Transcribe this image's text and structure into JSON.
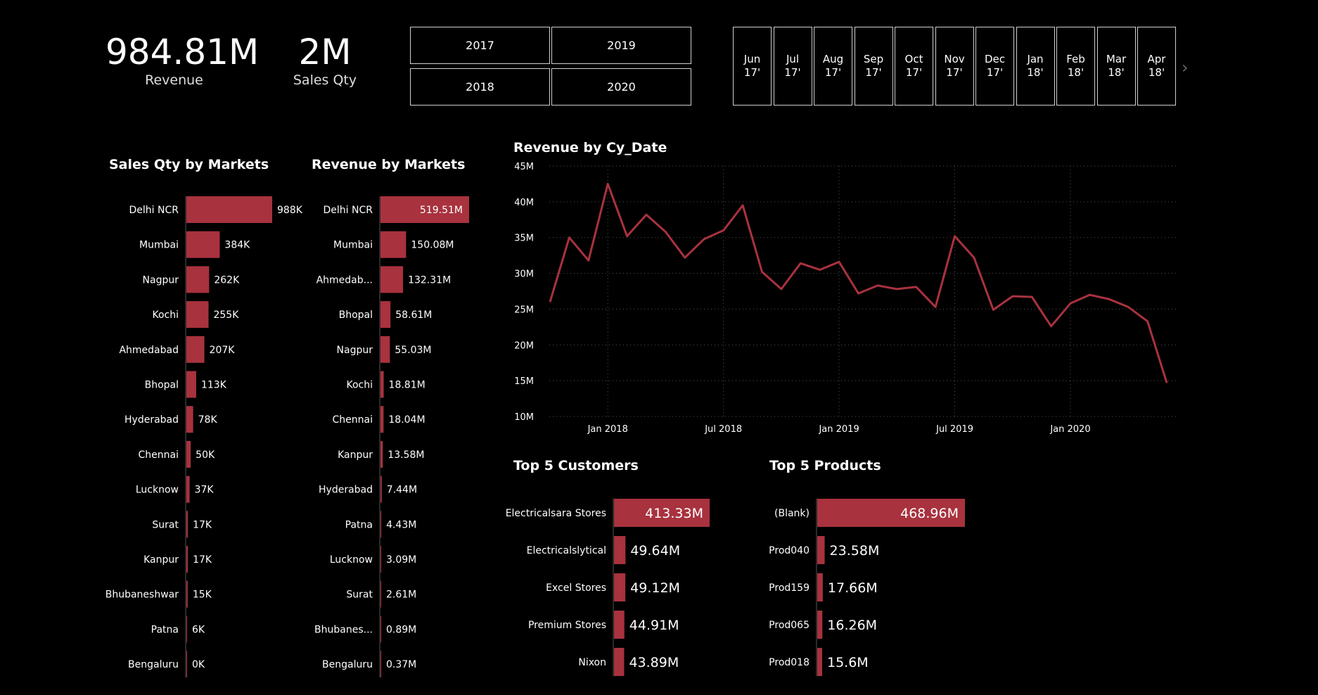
{
  "kpis": {
    "revenue": {
      "value": "984.81M",
      "label": "Revenue"
    },
    "sales_qty": {
      "value": "2M",
      "label": "Sales Qty"
    }
  },
  "year_slicer": [
    "2017",
    "2019",
    "2018",
    "2020"
  ],
  "month_slicer": [
    {
      "m": "Jun",
      "y": "17'"
    },
    {
      "m": "Jul",
      "y": "17'"
    },
    {
      "m": "Aug",
      "y": "17'"
    },
    {
      "m": "Sep",
      "y": "17'"
    },
    {
      "m": "Oct",
      "y": "17'"
    },
    {
      "m": "Nov",
      "y": "17'"
    },
    {
      "m": "Dec",
      "y": "17'"
    },
    {
      "m": "Jan",
      "y": "18'"
    },
    {
      "m": "Feb",
      "y": "18'"
    },
    {
      "m": "Mar",
      "y": "18'"
    },
    {
      "m": "Apr",
      "y": "18'"
    }
  ],
  "colors": {
    "accent": "#a8323e",
    "background": "#000000",
    "grid": "#555555"
  },
  "chart_data": [
    {
      "type": "bar",
      "orientation": "horizontal",
      "title": "Sales Qty by Markets",
      "categories": [
        "Delhi NCR",
        "Mumbai",
        "Nagpur",
        "Kochi",
        "Ahmedabad",
        "Bhopal",
        "Hyderabad",
        "Chennai",
        "Lucknow",
        "Surat",
        "Kanpur",
        "Bhubaneshwar",
        "Patna",
        "Bengaluru"
      ],
      "values": [
        988,
        384,
        262,
        255,
        207,
        113,
        78,
        50,
        37,
        17,
        17,
        15,
        6,
        0
      ],
      "labels": [
        "988K",
        "384K",
        "262K",
        "255K",
        "207K",
        "113K",
        "78K",
        "50K",
        "37K",
        "17K",
        "17K",
        "15K",
        "6K",
        "0K"
      ],
      "unit": "K"
    },
    {
      "type": "bar",
      "orientation": "horizontal",
      "title": "Revenue by Markets",
      "categories": [
        "Delhi NCR",
        "Mumbai",
        "Ahmedab...",
        "Bhopal",
        "Nagpur",
        "Kochi",
        "Chennai",
        "Kanpur",
        "Hyderabad",
        "Patna",
        "Lucknow",
        "Surat",
        "Bhubanes...",
        "Bengaluru"
      ],
      "values": [
        519.51,
        150.08,
        132.31,
        58.61,
        55.03,
        18.81,
        18.04,
        13.58,
        7.44,
        4.43,
        3.09,
        2.61,
        0.89,
        0.37
      ],
      "labels": [
        "519.51M",
        "150.08M",
        "132.31M",
        "58.61M",
        "55.03M",
        "18.81M",
        "18.04M",
        "13.58M",
        "7.44M",
        "4.43M",
        "3.09M",
        "2.61M",
        "0.89M",
        "0.37M"
      ],
      "unit": "M"
    },
    {
      "type": "line",
      "title": "Revenue by Cy_Date",
      "x": [
        "2017-10",
        "2017-11",
        "2017-12",
        "2018-01",
        "2018-02",
        "2018-03",
        "2018-04",
        "2018-05",
        "2018-06",
        "2018-07",
        "2018-08",
        "2018-09",
        "2018-10",
        "2018-11",
        "2018-12",
        "2019-01",
        "2019-02",
        "2019-03",
        "2019-04",
        "2019-05",
        "2019-06",
        "2019-07",
        "2019-08",
        "2019-09",
        "2019-10",
        "2019-11",
        "2019-12",
        "2020-01",
        "2020-02",
        "2020-03",
        "2020-04",
        "2020-05",
        "2020-06"
      ],
      "y": [
        26.0,
        35.0,
        31.8,
        42.5,
        35.2,
        38.2,
        35.8,
        32.2,
        34.8,
        36.0,
        39.5,
        30.2,
        27.8,
        31.4,
        30.5,
        31.6,
        27.2,
        28.3,
        27.8,
        28.1,
        25.3,
        35.2,
        32.2,
        24.9,
        26.8,
        26.7,
        22.6,
        25.8,
        27.0,
        26.4,
        25.3,
        23.3,
        14.7
      ],
      "ylim": [
        10,
        45
      ],
      "yticks": [
        "45M",
        "40M",
        "35M",
        "30M",
        "25M",
        "20M",
        "15M",
        "10M"
      ],
      "xticks": [
        {
          "at": "2018-01",
          "label": "Jan 2018"
        },
        {
          "at": "2018-07",
          "label": "Jul 2018"
        },
        {
          "at": "2019-01",
          "label": "Jan 2019"
        },
        {
          "at": "2019-07",
          "label": "Jul 2019"
        },
        {
          "at": "2020-01",
          "label": "Jan 2020"
        }
      ],
      "grid": true,
      "unit": "M"
    },
    {
      "type": "bar",
      "orientation": "horizontal",
      "title": "Top 5 Customers",
      "categories": [
        "Electricalsara Stores",
        "Electricalslytical",
        "Excel Stores",
        "Premium Stores",
        "Nixon"
      ],
      "values": [
        413.33,
        49.64,
        49.12,
        44.91,
        43.89
      ],
      "labels": [
        "413.33M",
        "49.64M",
        "49.12M",
        "44.91M",
        "43.89M"
      ],
      "unit": "M"
    },
    {
      "type": "bar",
      "orientation": "horizontal",
      "title": "Top 5 Products",
      "categories": [
        "(Blank)",
        "Prod040",
        "Prod159",
        "Prod065",
        "Prod018"
      ],
      "values": [
        468.96,
        23.58,
        17.66,
        16.26,
        15.6
      ],
      "labels": [
        "468.96M",
        "23.58M",
        "17.66M",
        "16.26M",
        "15.6M"
      ],
      "unit": "M"
    }
  ]
}
